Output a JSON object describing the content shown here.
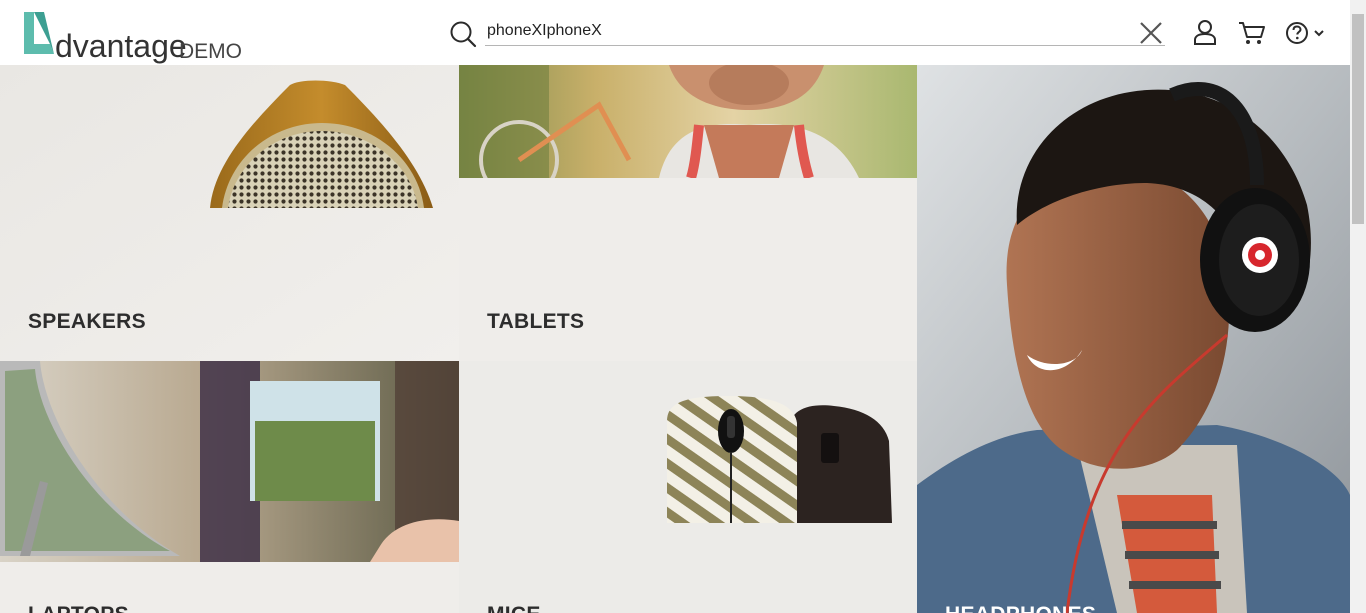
{
  "header": {
    "logo_text": "dvantage",
    "logo_suffix": "DEMO",
    "search": {
      "value": "phoneXIphoneX",
      "placeholder": ""
    }
  },
  "tiles": [
    {
      "label": "SPEAKERS"
    },
    {
      "label": "TABLETS"
    },
    {
      "label": "HEADPHONES"
    },
    {
      "label": "LAPTOPS"
    },
    {
      "label": "MICE"
    }
  ],
  "icons": {
    "search": "search-icon",
    "clear": "close-icon",
    "user": "user-icon",
    "cart": "cart-icon",
    "help": "help-icon"
  },
  "colors": {
    "brand_teal": "#5dbcad",
    "label_dark": "#2d2d2d",
    "label_light": "#ffffff"
  }
}
